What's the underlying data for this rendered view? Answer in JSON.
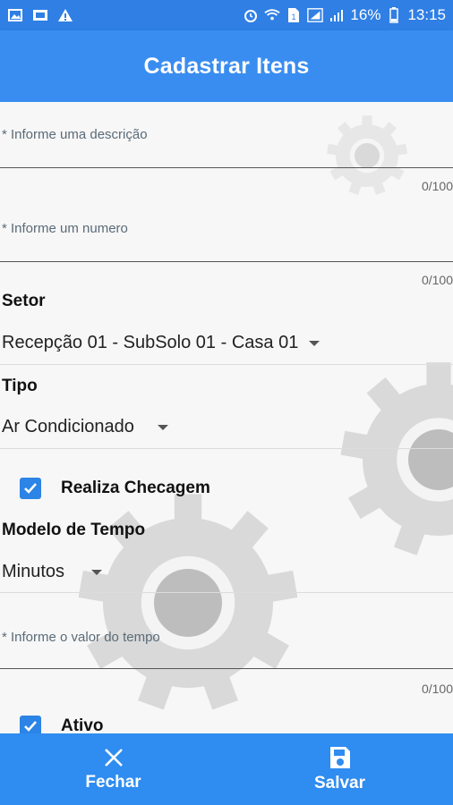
{
  "status_bar": {
    "battery": "16%",
    "time": "13:15",
    "left_icons": [
      "image-icon",
      "cast-icon",
      "warning-icon"
    ],
    "right_icons": [
      "alarm-icon",
      "wifi-icon",
      "sim-icon",
      "signal-icon",
      "battery-icon"
    ]
  },
  "header": {
    "title": "Cadastrar Itens"
  },
  "form": {
    "descricao": {
      "placeholder": "* Informe uma descrição",
      "counter": "0/100"
    },
    "numero": {
      "placeholder": "* Informe um numero",
      "counter": "0/100"
    },
    "setor": {
      "label": "Setor",
      "value": "Recepção 01 - SubSolo 01 - Casa 01"
    },
    "tipo": {
      "label": "Tipo",
      "value": "Ar Condicionado"
    },
    "realiza_checagem": {
      "label": "Realiza Checagem",
      "checked": true
    },
    "modelo_tempo": {
      "label": "Modelo de Tempo",
      "value": "Minutos"
    },
    "valor_tempo": {
      "placeholder": "* Informe o valor do tempo",
      "counter": "0/100"
    },
    "ativo": {
      "label": "Ativo",
      "checked": true
    }
  },
  "footer": {
    "close_label": "Fechar",
    "save_label": "Salvar"
  },
  "colors": {
    "status_bar": "#2f7fe4",
    "app_bar": "#3a8df0",
    "bottom_bar": "#2f8cf0",
    "checkbox": "#2b84e6"
  }
}
